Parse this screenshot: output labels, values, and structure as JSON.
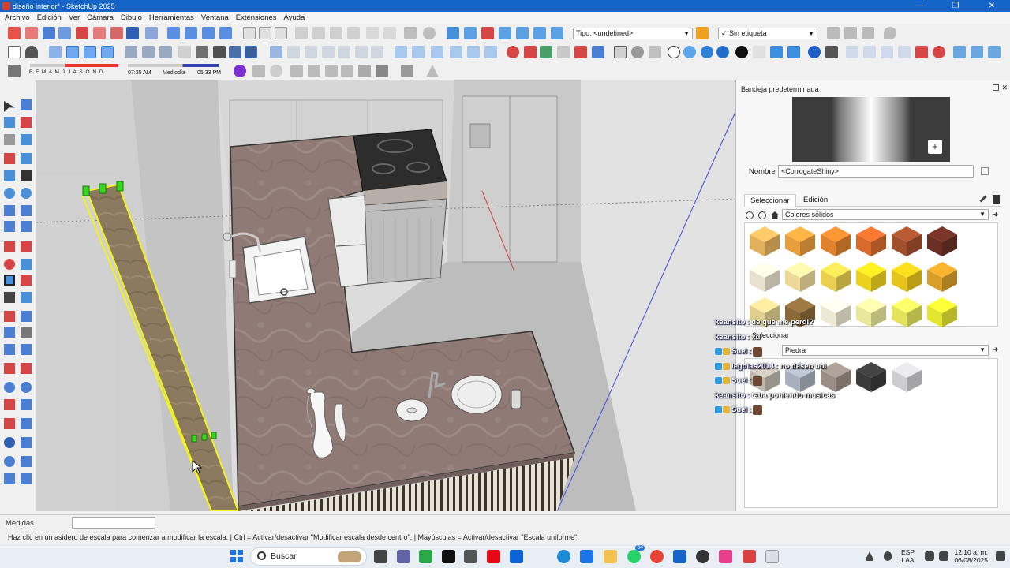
{
  "window": {
    "title": "diseño interior* - SketchUp 2025",
    "controls": [
      "—",
      "❐",
      "✕"
    ]
  },
  "menu": [
    "Archivo",
    "Edición",
    "Ver",
    "Cámara",
    "Dibujo",
    "Herramientas",
    "Ventana",
    "Extensiones",
    "Ayuda"
  ],
  "toolbar": {
    "type_combo": "Tipo: <undefined>",
    "tag_combo": "Sin etiqueta",
    "shadow_months": "E F M A M J J A S O N D",
    "shadow_time_start": "07:35 AM",
    "shadow_time_mid": "Mediodía",
    "shadow_time_end": "05:33 PM"
  },
  "tray": {
    "title": "Bandeja predeterminada",
    "name_label": "Nombre",
    "material_name": "<CorrogateShiny>",
    "tabs": [
      "Seleccionar",
      "Edición"
    ],
    "library_top": "Colores sólidos",
    "library_bottom": "Piedra",
    "section_label": "Seleccionar",
    "top_colors": [
      "#e3b15b",
      "#e79e3c",
      "#e0822d",
      "#d96a2d",
      "#a24f2d",
      "#6a3024",
      "#e8e1cd",
      "#ecd99a",
      "#e9d04f",
      "#ecd21f",
      "#e8c31a",
      "#d99d2a",
      "#e0cf8e",
      "#8a6a3a",
      "#ece8d2",
      "#e7e89a",
      "#e5e35c",
      "#e3e531"
    ],
    "stone_colors": [
      "#bdb7ad",
      "#a8b0bd",
      "#9b8e86",
      "#3b3b3b",
      "#cdcdd0"
    ]
  },
  "chat": [
    {
      "user": "keansito",
      "msg": ": de que me perdi?",
      "badges": false
    },
    {
      "user": "keansito",
      "msg": ": xd",
      "badges": false
    },
    {
      "user": "Suel",
      "msg": ":",
      "badges": true,
      "avatar": true
    },
    {
      "user": "legolas2014",
      "msg": ": no deseo boi",
      "badges": true
    },
    {
      "user": "Suel",
      "msg": ":",
      "badges": true,
      "avatar": true
    },
    {
      "user": "keansito",
      "msg": ": taba poniendo musicas",
      "badges": false
    },
    {
      "user": "Suel",
      "msg": ":",
      "badges": true,
      "avatar": true
    }
  ],
  "measure": {
    "label": "Medidas",
    "value": ""
  },
  "status": "Haz clic en un asidero de escala para comenzar a modificar la escala. | Ctrl = Activar/desactivar \"Modificar escala desde centro\". | Mayúsculas = Activar/desactivar \"Escala uniforme\".",
  "taskbar": {
    "search_placeholder": "Buscar",
    "lang_line1": "ESP",
    "lang_line2": "LAA",
    "time": "12:10 a. m.",
    "date": "06/08/2025",
    "badge_count": "34"
  },
  "colors": {
    "accent": "#1565c8",
    "selection": "#f3f31a",
    "grip": "#39d61f",
    "countertop": "#8f7a76"
  }
}
